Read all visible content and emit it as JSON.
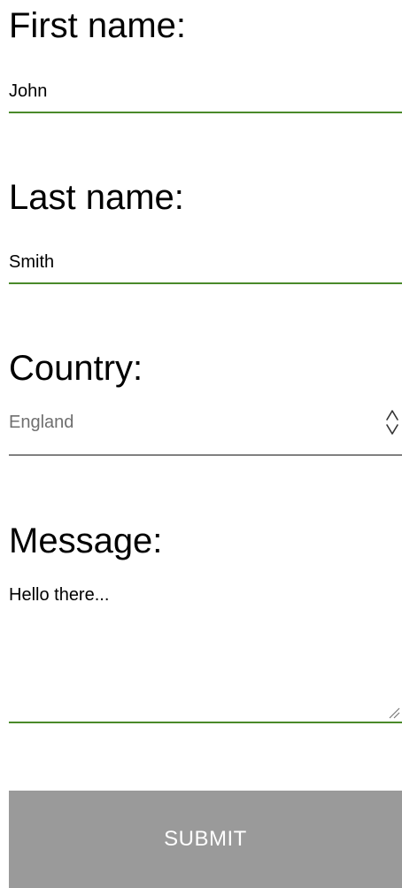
{
  "form": {
    "first_name": {
      "label": "First name:",
      "value": "John"
    },
    "last_name": {
      "label": "Last name:",
      "value": "Smith"
    },
    "country": {
      "label": "Country:",
      "selected": "England",
      "icon": "select-arrows-icon"
    },
    "message": {
      "label": "Message:",
      "value": "Hello there...",
      "icon": "resize-grip-icon"
    },
    "submit_label": "SUBMIT"
  },
  "colors": {
    "accent_underline": "#4a8a2a",
    "select_underline": "#808080",
    "select_text": "#6f6f6f",
    "submit_background": "#9a9a9a",
    "submit_text": "#ffffff"
  }
}
